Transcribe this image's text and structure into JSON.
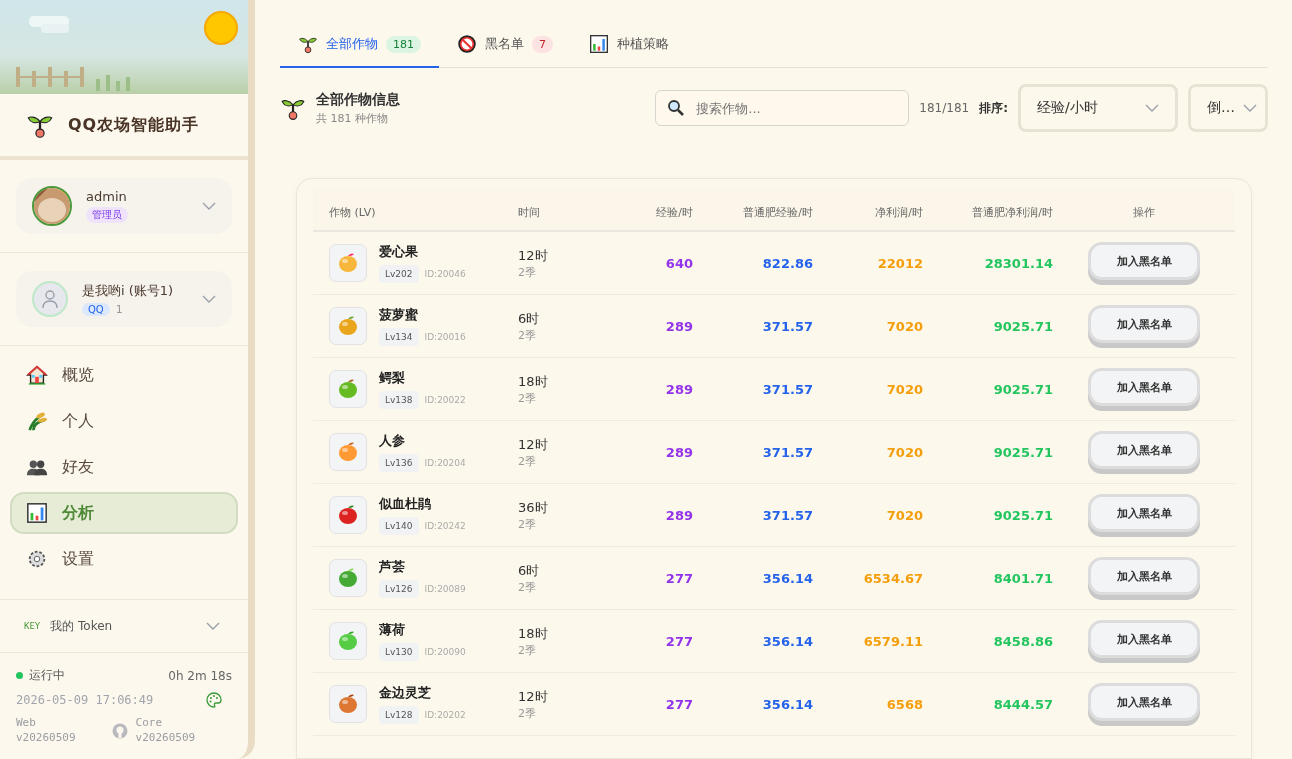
{
  "sidebar": {
    "app_title": "QQ农场智能助手",
    "user": {
      "name": "admin",
      "role": "管理员"
    },
    "account": {
      "name": "是我哟i (账号1)",
      "platform": "QQ",
      "count": "1"
    },
    "nav": [
      {
        "label": "概览",
        "kind": "house",
        "selected": false
      },
      {
        "label": "个人",
        "kind": "wheat",
        "selected": false
      },
      {
        "label": "好友",
        "kind": "people",
        "selected": false
      },
      {
        "label": "分析",
        "kind": "chart",
        "selected": true
      },
      {
        "label": "设置",
        "kind": "gear",
        "selected": false
      }
    ],
    "token": {
      "badge": "KEY",
      "label": "我的 Token"
    },
    "status": {
      "state": "运行中",
      "running": true,
      "uptime": "0h 2m 18s",
      "datetime": "2026-05-09 17:06:49",
      "web_label": "Web",
      "web_version": "v20260509",
      "core_label": "Core",
      "core_version": "v20260509"
    }
  },
  "tabs": [
    {
      "label": "全部作物",
      "count": "181",
      "kind": "sprout",
      "selected": true
    },
    {
      "label": "黑名单",
      "count": "7",
      "kind": "ban",
      "selected": false
    },
    {
      "label": "种植策略",
      "kind": "chart",
      "selected": false
    }
  ],
  "header": {
    "title": "全部作物信息",
    "subtitle": "共 181 种作物",
    "search_placeholder": "搜索作物...",
    "result_count": "181/181",
    "sort_label": "排序:",
    "sort_value": "经验/小时",
    "order_value": "倒…"
  },
  "table": {
    "columns": [
      "作物 (LV)",
      "时间",
      "经验/时",
      "普通肥经验/时",
      "净利润/时",
      "普通肥净利润/时",
      "操作"
    ],
    "rows": [
      {
        "name": "爱心果",
        "level": "Lv202",
        "id": "ID:20046",
        "time": "12时",
        "seasons": "2季",
        "exp": "640",
        "fert_exp": "822.86",
        "profit": "22012",
        "fert_profit": "28301.14",
        "action": "加入黑名单"
      },
      {
        "name": "菠萝蜜",
        "level": "Lv134",
        "id": "ID:20016",
        "time": "6时",
        "seasons": "2季",
        "exp": "289",
        "fert_exp": "371.57",
        "profit": "7020",
        "fert_profit": "9025.71",
        "action": "加入黑名单"
      },
      {
        "name": "鳄梨",
        "level": "Lv138",
        "id": "ID:20022",
        "time": "18时",
        "seasons": "2季",
        "exp": "289",
        "fert_exp": "371.57",
        "profit": "7020",
        "fert_profit": "9025.71",
        "action": "加入黑名单"
      },
      {
        "name": "人参",
        "level": "Lv136",
        "id": "ID:20204",
        "time": "12时",
        "seasons": "2季",
        "exp": "289",
        "fert_exp": "371.57",
        "profit": "7020",
        "fert_profit": "9025.71",
        "action": "加入黑名单"
      },
      {
        "name": "似血杜鹃",
        "level": "Lv140",
        "id": "ID:20242",
        "time": "36时",
        "seasons": "2季",
        "exp": "289",
        "fert_exp": "371.57",
        "profit": "7020",
        "fert_profit": "9025.71",
        "action": "加入黑名单"
      },
      {
        "name": "芦荟",
        "level": "Lv126",
        "id": "ID:20089",
        "time": "6时",
        "seasons": "2季",
        "exp": "277",
        "fert_exp": "356.14",
        "profit": "6534.67",
        "fert_profit": "8401.71",
        "action": "加入黑名单"
      },
      {
        "name": "薄荷",
        "level": "Lv130",
        "id": "ID:20090",
        "time": "18时",
        "seasons": "2季",
        "exp": "277",
        "fert_exp": "356.14",
        "profit": "6579.11",
        "fert_profit": "8458.86",
        "action": "加入黑名单"
      },
      {
        "name": "金边灵芝",
        "level": "Lv128",
        "id": "ID:20202",
        "time": "12时",
        "seasons": "2季",
        "exp": "277",
        "fert_exp": "356.14",
        "profit": "6568",
        "fert_profit": "8444.57",
        "action": "加入黑名单"
      }
    ]
  }
}
